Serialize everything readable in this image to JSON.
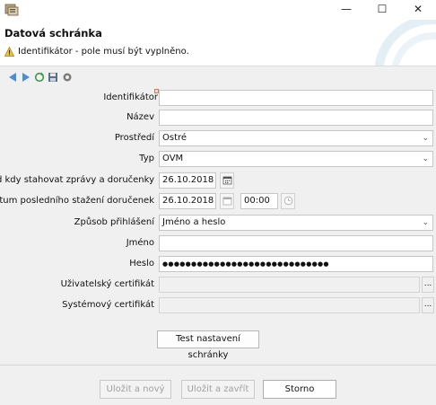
{
  "window": {
    "minimize_glyph": "—",
    "maximize_glyph": "☐",
    "close_glyph": "✕"
  },
  "header": {
    "title": "Datová schránka",
    "message": "Identifikátor - pole musí být vyplněno."
  },
  "toolbar": {
    "icons": [
      "arrow-left-icon",
      "arrow-right-icon",
      "refresh-icon",
      "save-icon",
      "settings-icon"
    ]
  },
  "form": {
    "identifikator": {
      "label": "Identifikátor",
      "value": ""
    },
    "nazev": {
      "label": "Název",
      "value": ""
    },
    "prostredi": {
      "label": "Prostředí",
      "value": "Ostré"
    },
    "typ": {
      "label": "Typ",
      "value": "OVM"
    },
    "od_kdy": {
      "label": "Od kdy stahovat zprávy a doručenky",
      "value": "26.10.2018"
    },
    "datum_posledniho": {
      "label": "Datum posledního stažení doručenek",
      "date": "26.10.2018",
      "time": "00:00"
    },
    "zpusob": {
      "label": "Způsob přihlášení",
      "value": "Jméno a heslo"
    },
    "jmeno": {
      "label": "Jméno",
      "value": ""
    },
    "heslo": {
      "label": "Heslo",
      "value": "●●●●●●●●●●●●●●●●●●●●●●●●●●●●●"
    },
    "uziv_cert": {
      "label": "Uživatelský certifikát",
      "value": "",
      "browse": "..."
    },
    "sys_cert": {
      "label": "Systémový certifikát",
      "value": "",
      "browse": "..."
    },
    "test_button": "Test nastavení schránky"
  },
  "footer": {
    "save_new": "Uložit a nový",
    "save_close": "Uložit a zavřít",
    "cancel": "Storno"
  }
}
